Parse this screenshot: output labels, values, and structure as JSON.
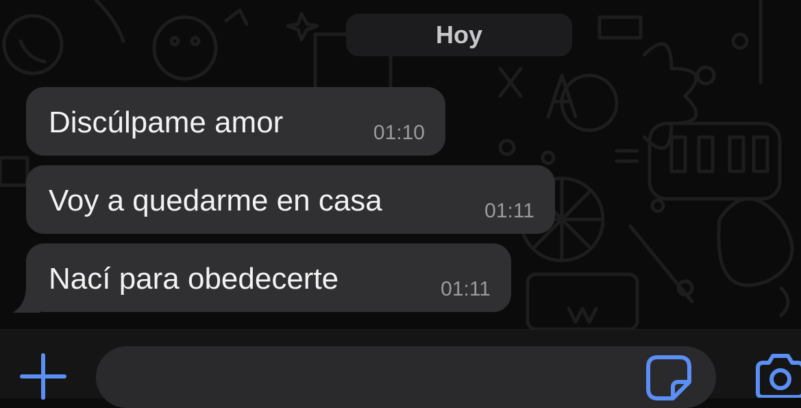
{
  "date_separator": "Hoy",
  "messages": [
    {
      "text": "Discúlpame amor",
      "time": "01:10"
    },
    {
      "text": "Voy a quedarme en casa",
      "time": "01:11"
    },
    {
      "text": "Nací para obedecerte",
      "time": "01:11"
    }
  ],
  "composer": {
    "input_value": "",
    "icons": [
      "plus-icon",
      "sticker-icon",
      "camera-icon"
    ]
  },
  "colors": {
    "background": "#0b0b0b",
    "bubble": "#303033",
    "accent": "#5b8ff5"
  }
}
